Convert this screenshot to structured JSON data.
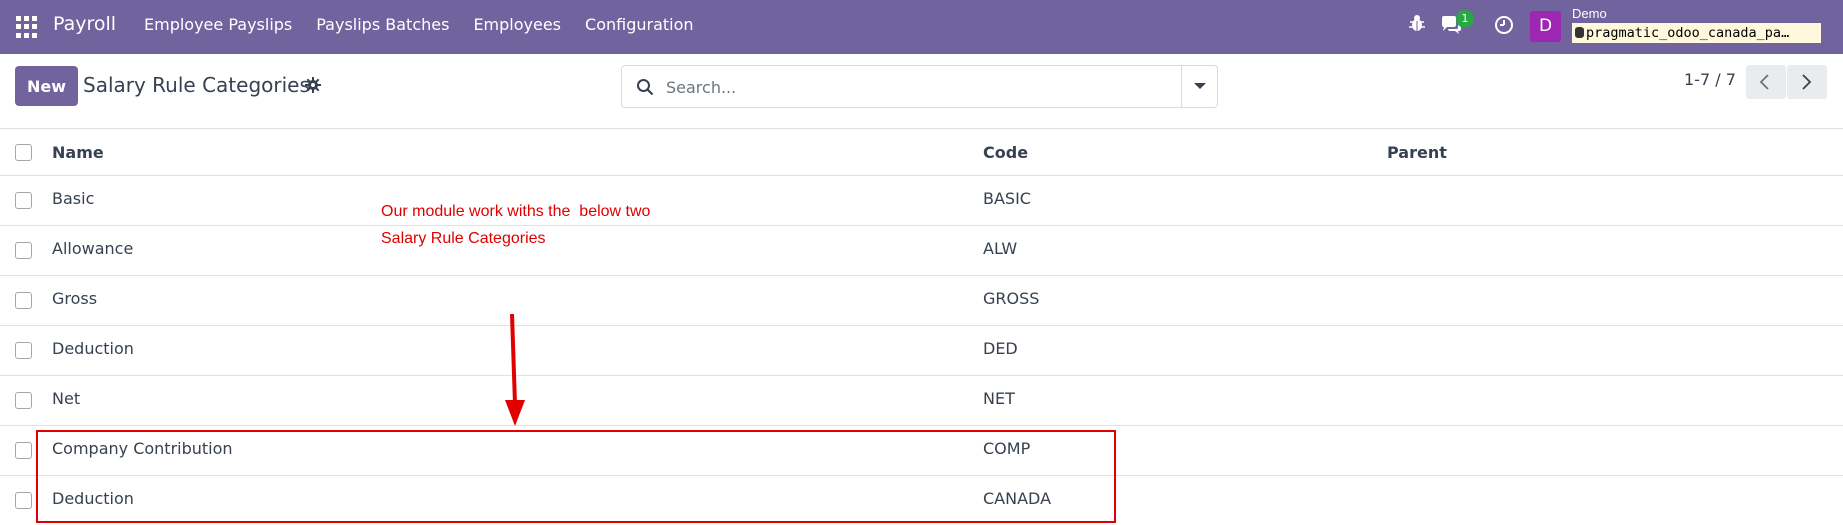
{
  "navbar": {
    "app_name": "Payroll",
    "menu": [
      "Employee Payslips",
      "Payslips Batches",
      "Employees",
      "Configuration"
    ],
    "chat_badge": "1",
    "user_initial": "D",
    "user_name": "Demo",
    "database": "pragmatic_odoo_canada_pa…",
    "color": "#71639e"
  },
  "control_panel": {
    "new_label": "New",
    "title": "Salary Rule Categories",
    "search_placeholder": "Search...",
    "pager": "1-7 / 7"
  },
  "table": {
    "headers": {
      "name": "Name",
      "code": "Code",
      "parent": "Parent"
    },
    "rows": [
      {
        "name": "Basic",
        "code": "BASIC",
        "parent": ""
      },
      {
        "name": "Allowance",
        "code": "ALW",
        "parent": ""
      },
      {
        "name": "Gross",
        "code": "GROSS",
        "parent": ""
      },
      {
        "name": "Deduction",
        "code": "DED",
        "parent": ""
      },
      {
        "name": "Net",
        "code": "NET",
        "parent": ""
      },
      {
        "name": "Company Contribution",
        "code": "COMP",
        "parent": ""
      },
      {
        "name": "Deduction",
        "code": "CANADA",
        "parent": ""
      }
    ]
  },
  "annotation": {
    "text": "Our module work withs the  below two\nSalary Rule Categories",
    "color": "#e00000"
  }
}
